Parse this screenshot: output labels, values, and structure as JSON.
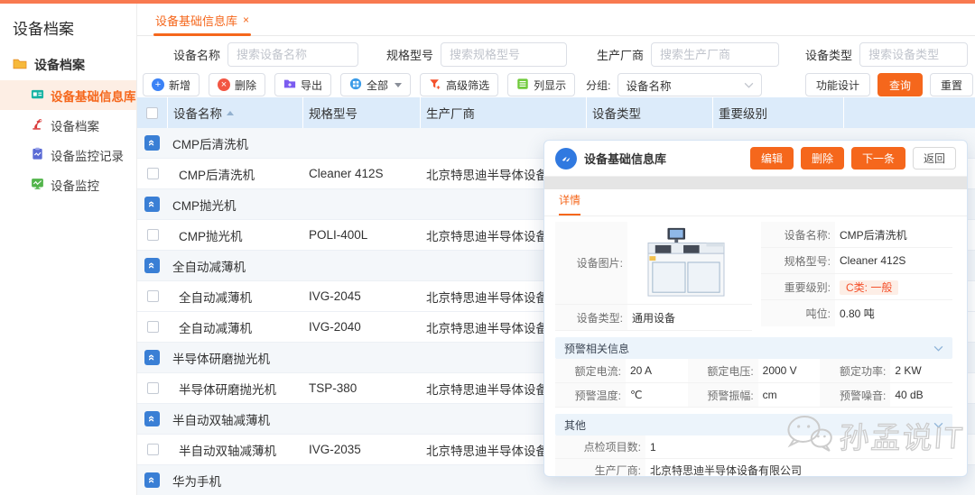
{
  "sidebar": {
    "title": "设备档案",
    "root": {
      "label": "设备档案"
    },
    "items": [
      {
        "label": "设备基础信息库"
      },
      {
        "label": "设备档案"
      },
      {
        "label": "设备监控记录"
      },
      {
        "label": "设备监控"
      }
    ]
  },
  "tab": {
    "label": "设备基础信息库",
    "close": "×"
  },
  "filters": [
    {
      "label": "设备名称",
      "placeholder": "搜索设备名称"
    },
    {
      "label": "规格型号",
      "placeholder": "搜索规格型号"
    },
    {
      "label": "生产厂商",
      "placeholder": "搜索生产厂商"
    },
    {
      "label": "设备类型",
      "placeholder": "搜索设备类型"
    }
  ],
  "toolbar": {
    "add": "新增",
    "delete": "删除",
    "export": "导出",
    "all": "全部",
    "advanced_filter": "高级筛选",
    "column_display": "列显示",
    "group_label": "分组:",
    "group_value": "设备名称",
    "function_design": "功能设计",
    "query": "查询",
    "reset": "重置"
  },
  "table": {
    "headers": {
      "name": "设备名称",
      "model": "规格型号",
      "manufacturer": "生产厂商",
      "type": "设备类型",
      "level": "重要级别"
    },
    "rows": [
      {
        "type": "group",
        "name": "CMP后清洗机"
      },
      {
        "type": "item",
        "name": "CMP后清洗机",
        "model": "Cleaner 412S",
        "manufacturer": "北京特思迪半导体设备有限公司"
      },
      {
        "type": "group",
        "name": "CMP抛光机"
      },
      {
        "type": "item",
        "name": "CMP抛光机",
        "model": "POLI-400L",
        "manufacturer": "北京特思迪半导体设备有限公司"
      },
      {
        "type": "group",
        "name": "全自动减薄机"
      },
      {
        "type": "item",
        "name": "全自动减薄机",
        "model": "IVG-2045",
        "manufacturer": "北京特思迪半导体设备有限公司"
      },
      {
        "type": "item",
        "name": "全自动减薄机",
        "model": "IVG-2040",
        "manufacturer": "北京特思迪半导体设备有限公司"
      },
      {
        "type": "group",
        "name": "半导体研磨抛光机"
      },
      {
        "type": "item",
        "name": "半导体研磨抛光机",
        "model": "TSP-380",
        "manufacturer": "北京特思迪半导体设备有限公司"
      },
      {
        "type": "group",
        "name": "半自动双轴减薄机"
      },
      {
        "type": "item",
        "name": "半自动双轴减薄机",
        "model": "IVG-2035",
        "manufacturer": "北京特思迪半导体设备有限公司"
      },
      {
        "type": "group",
        "name": "华为手机"
      }
    ]
  },
  "modal": {
    "title": "设备基础信息库",
    "buttons": {
      "edit": "编辑",
      "delete": "删除",
      "next": "下一条",
      "back": "返回"
    },
    "tab": "详情",
    "fields": {
      "photo_label": "设备图片:",
      "name_label": "设备名称:",
      "name": "CMP后清洗机",
      "model_label": "规格型号:",
      "model": "Cleaner 412S",
      "level_label": "重要级别:",
      "level": "C类: 一般",
      "tonnage_label": "吨位:",
      "tonnage": "0.80 吨",
      "type_label": "设备类型:",
      "type": "通用设备"
    },
    "warning_section": {
      "title": "预警相关信息",
      "fields": [
        {
          "label": "额定电流:",
          "value": "20 A"
        },
        {
          "label": "额定电压:",
          "value": "2000 V"
        },
        {
          "label": "额定功率:",
          "value": "2 KW"
        },
        {
          "label": "预警温度:",
          "value": "℃"
        },
        {
          "label": "预警振幅:",
          "value": "cm"
        },
        {
          "label": "预警噪音:",
          "value": "40 dB"
        }
      ]
    },
    "other_section": {
      "title": "其他",
      "fields": [
        {
          "label": "点检项目数:",
          "value": "1"
        },
        {
          "label": "生产厂商:",
          "value": "北京特思迪半导体设备有限公司"
        }
      ]
    }
  },
  "watermark": {
    "text": "孙孟说IT"
  },
  "colors": {
    "accent": "#f5671c",
    "header_bg": "#dcebfa",
    "group_icon": "#3a7fd5"
  }
}
